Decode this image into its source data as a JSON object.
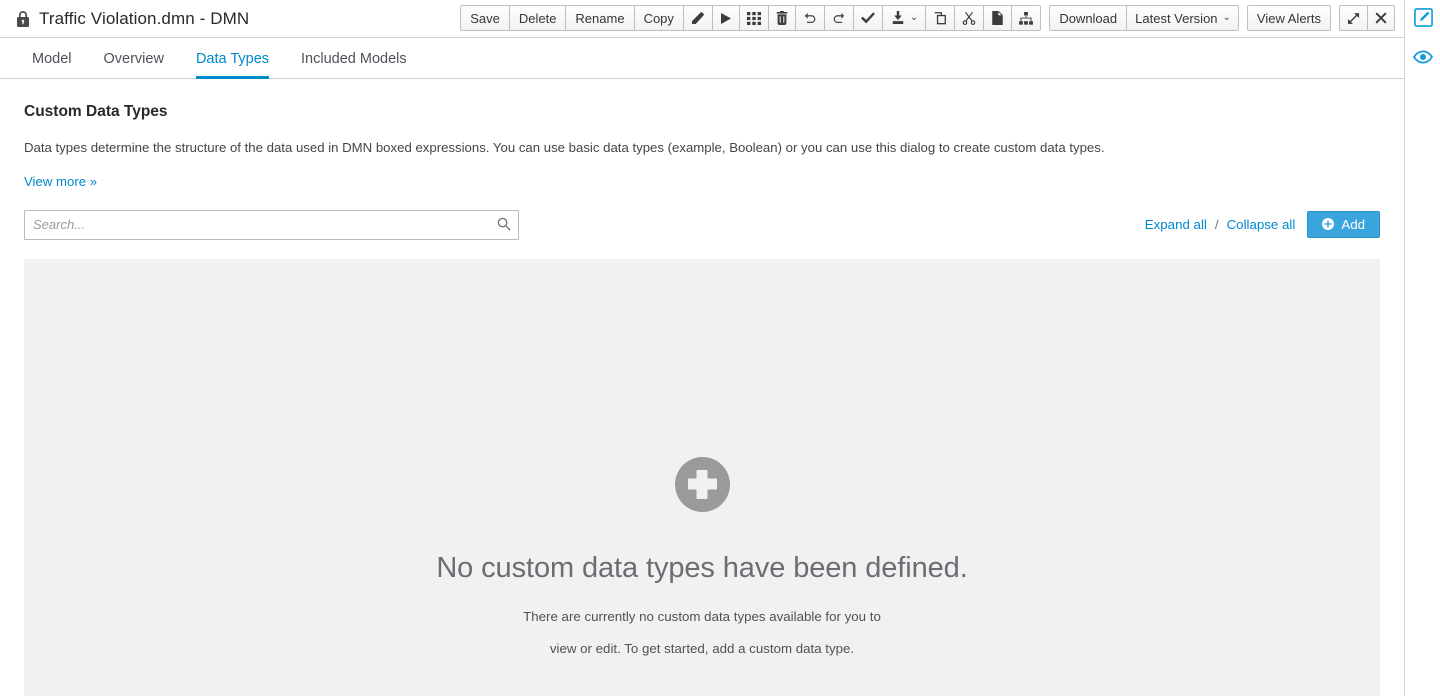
{
  "window": {
    "title": "Traffic Violation.dmn - DMN",
    "lock_icon": "lock-icon"
  },
  "toolbar": {
    "save_label": "Save",
    "delete_label": "Delete",
    "rename_label": "Rename",
    "copy_label": "Copy",
    "eraser_icon": "eraser-icon",
    "play_icon": "play-icon",
    "grid_icon": "grid-icon",
    "trash_icon": "trash-icon",
    "undo_icon": "undo-icon",
    "redo_icon": "redo-icon",
    "validate_icon": "check-icon",
    "save_as_icon": "save-to-disk-icon",
    "save_as_caret": "⌄",
    "duplicate_icon": "duplicate-icon",
    "cut_icon": "scissors-icon",
    "paste_icon": "paste-icon",
    "hierarchy_icon": "sitemap-icon",
    "download_label": "Download",
    "version_label": "Latest Version",
    "version_caret": "⌄",
    "alerts_label": "View Alerts",
    "maximize_icon": "expand-arrows-icon",
    "close_icon": "close-icon"
  },
  "tabs": [
    {
      "label": "Model",
      "active": false
    },
    {
      "label": "Overview",
      "active": false
    },
    {
      "label": "Data Types",
      "active": true
    },
    {
      "label": "Included Models",
      "active": false
    }
  ],
  "main": {
    "section_title": "Custom Data Types",
    "section_description": "Data types determine the structure of the data used in DMN boxed expressions. You can use basic data types (example, Boolean) or you can use this dialog to create custom data types.",
    "view_more_label": "View more »"
  },
  "controls": {
    "search_placeholder": "Search...",
    "search_value": "",
    "search_icon": "search-icon",
    "expand_all_label": "Expand all",
    "separator": "/",
    "collapse_all_label": "Collapse all",
    "add_label": "Add",
    "add_icon": "plus-circle-icon"
  },
  "empty_state": {
    "icon": "plus-circle-icon",
    "title": "No custom data types have been defined.",
    "line1": "There are currently no custom data types available for you to",
    "line2": "view or edit. To get started, add a custom data type."
  },
  "rail": {
    "edit_icon": "edit-pencil-icon",
    "preview_icon": "eye-icon"
  },
  "colors": {
    "accent_blue": "#0088ce",
    "button_blue": "#39a5dc",
    "panel_gray": "#f1f1f1",
    "empty_icon_gray": "#9a9a9a",
    "text_dark": "#292929"
  }
}
